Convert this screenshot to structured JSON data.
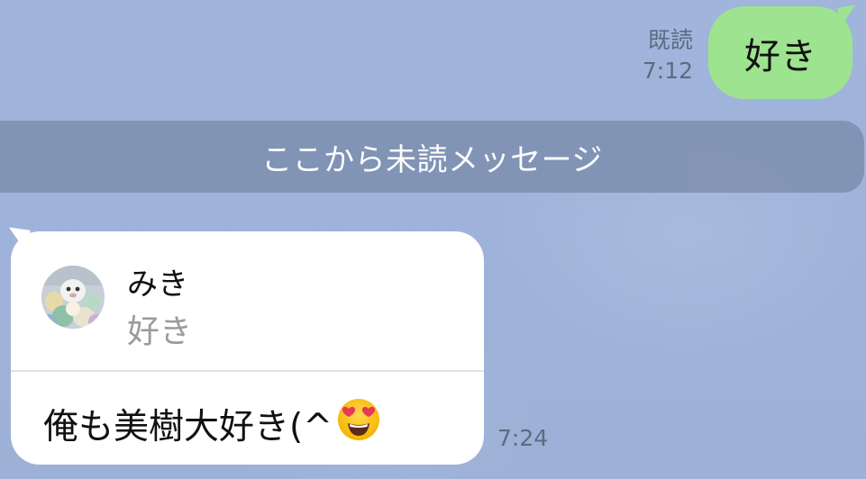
{
  "outgoing": {
    "read_label": "既読",
    "time": "7:12",
    "text": "好き"
  },
  "divider": {
    "label": "ここから未読メッセージ"
  },
  "incoming": {
    "reply_to": {
      "sender": "みき",
      "text": "好き",
      "avatar_icon": "photo-avatar-icon"
    },
    "text": "俺も美樹大好き(^",
    "emoji": "heart-eyes-emoji-icon",
    "time": "7:24"
  },
  "colors": {
    "background": "#9eb3d8",
    "outgoing_bubble": "#9ee38f",
    "divider": "#8193b4",
    "incoming_bubble": "#ffffff",
    "meta_text": "#5c6b80"
  }
}
